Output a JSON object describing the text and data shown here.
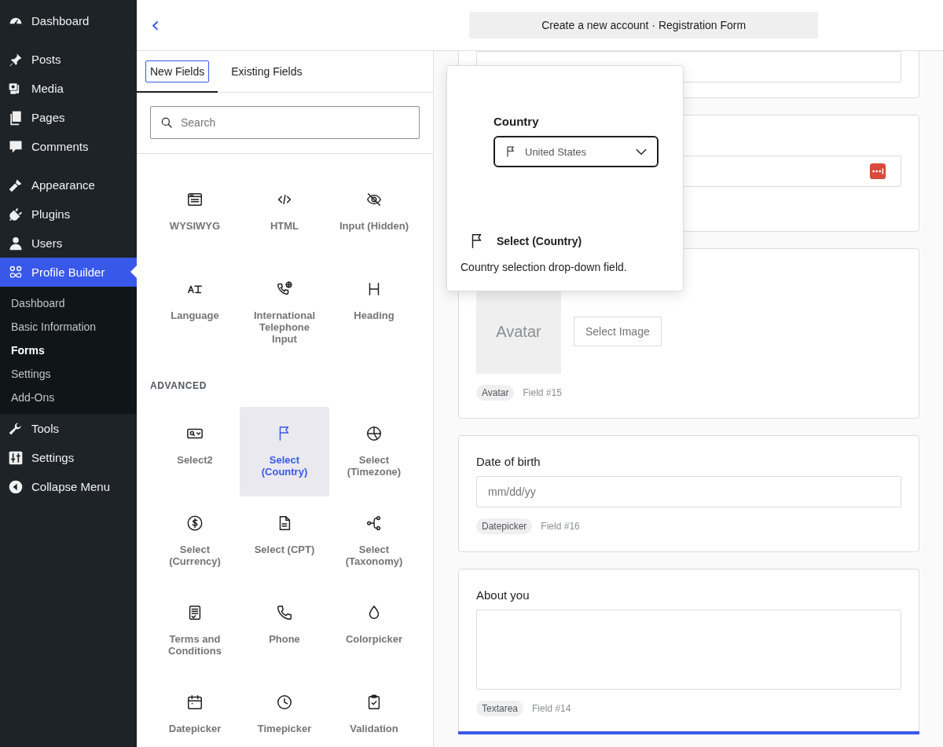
{
  "sidebar": {
    "groups": [
      [
        {
          "label": "Dashboard",
          "selected": false
        }
      ],
      [
        {
          "label": "Posts",
          "selected": false
        },
        {
          "label": "Media",
          "selected": false
        },
        {
          "label": "Pages",
          "selected": false
        },
        {
          "label": "Comments",
          "selected": false
        }
      ],
      [
        {
          "label": "Appearance",
          "selected": false
        },
        {
          "label": "Plugins",
          "selected": false
        },
        {
          "label": "Users",
          "selected": false
        },
        {
          "label": "Profile Builder",
          "selected": true,
          "children": [
            {
              "label": "Dashboard",
              "selected": false
            },
            {
              "label": "Basic Information",
              "selected": false
            },
            {
              "label": "Forms",
              "selected": true
            },
            {
              "label": "Settings",
              "selected": false
            },
            {
              "label": "Add-Ons",
              "selected": false
            }
          ]
        },
        {
          "label": "Tools",
          "selected": false
        },
        {
          "label": "Settings",
          "selected": false
        },
        {
          "label": "Collapse Menu",
          "selected": false
        }
      ]
    ]
  },
  "header": {
    "back": "‹",
    "title": "Create a new account · Registration Form"
  },
  "fields_panel": {
    "tabs": [
      {
        "label": "New Fields",
        "selected": true
      },
      {
        "label": "Existing Fields",
        "selected": false
      }
    ],
    "search": {
      "placeholder": "Search"
    },
    "sections": [
      {
        "items": [
          {
            "label": "WYSIWYG",
            "selected": false
          },
          {
            "label": "HTML",
            "selected": false
          },
          {
            "label": "Input (Hidden)",
            "selected": false
          },
          {
            "label": "Language",
            "selected": false
          },
          {
            "label": "International Telephone Input",
            "selected": false
          },
          {
            "label": "Heading",
            "selected": false
          }
        ]
      },
      {
        "title": "ADVANCED",
        "items": [
          {
            "label": "Select2",
            "selected": false
          },
          {
            "label": "Select (Country)",
            "selected": true
          },
          {
            "label": "Select (Timezone)",
            "selected": false
          },
          {
            "label": "Select (Currency)",
            "selected": false
          },
          {
            "label": "Select (CPT)",
            "selected": false
          },
          {
            "label": "Select (Taxonomy)",
            "selected": false
          },
          {
            "label": "Terms and Conditions",
            "selected": false
          },
          {
            "label": "Phone",
            "selected": false
          },
          {
            "label": "Colorpicker",
            "selected": false
          },
          {
            "label": "Datepicker",
            "selected": false
          },
          {
            "label": "Timepicker",
            "selected": false
          },
          {
            "label": "Validation",
            "selected": false
          }
        ]
      }
    ]
  },
  "form_cards": [
    {
      "kind": "input-tail"
    },
    {
      "kind": "password"
    },
    {
      "kind": "avatar",
      "placeholder_text": "Avatar",
      "button": "Select Image",
      "tag": "Avatar",
      "field": "Field #15"
    },
    {
      "kind": "date",
      "label": "Date of birth",
      "placeholder": "mm/dd/yy",
      "tag": "Datepicker",
      "field": "Field #16"
    },
    {
      "kind": "textarea",
      "label": "About you",
      "tag": "Textarea",
      "field": "Field #14"
    }
  ],
  "popover": {
    "preview_label": "Country",
    "preview_value": "United States",
    "title": "Select (Country)",
    "description": "Country selection drop-down field."
  }
}
